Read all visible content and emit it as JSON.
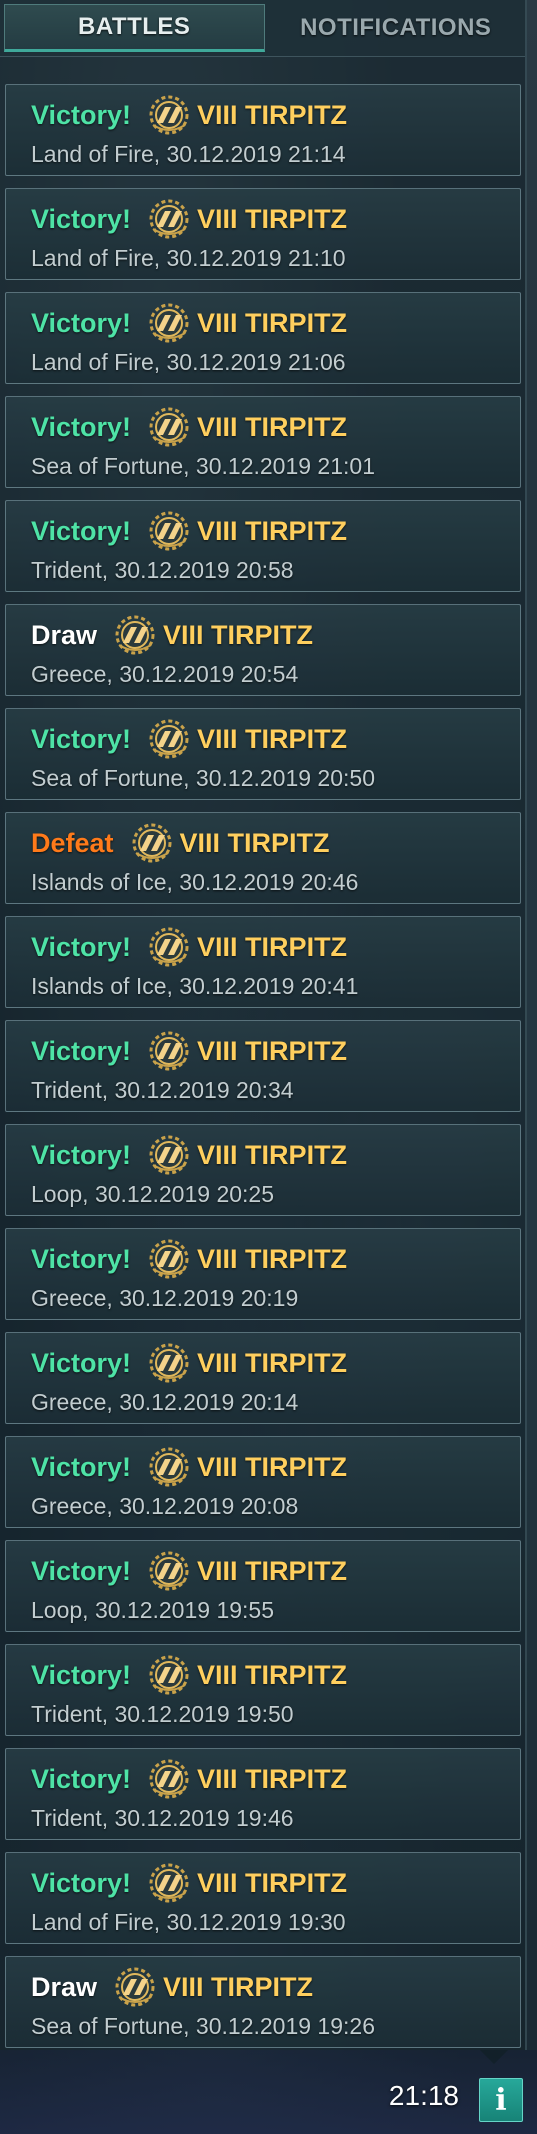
{
  "tabs": [
    {
      "label": "BATTLES",
      "active": true
    },
    {
      "label": "NOTIFICATIONS",
      "active": false
    }
  ],
  "colors": {
    "victory": "#4ee3a6",
    "draw": "#ffffff",
    "defeat": "#ff7a1a",
    "ship": "#ffcf5e",
    "accent": "#27a89a"
  },
  "battles": [
    {
      "result": "Victory!",
      "type": "victory",
      "ship": "VIII TIRPITZ",
      "details": "Land of Fire, 30.12.2019 21:14"
    },
    {
      "result": "Victory!",
      "type": "victory",
      "ship": "VIII TIRPITZ",
      "details": "Land of Fire, 30.12.2019 21:10"
    },
    {
      "result": "Victory!",
      "type": "victory",
      "ship": "VIII TIRPITZ",
      "details": "Land of Fire, 30.12.2019 21:06"
    },
    {
      "result": "Victory!",
      "type": "victory",
      "ship": "VIII TIRPITZ",
      "details": "Sea of Fortune, 30.12.2019 21:01"
    },
    {
      "result": "Victory!",
      "type": "victory",
      "ship": "VIII TIRPITZ",
      "details": "Trident, 30.12.2019 20:58"
    },
    {
      "result": "Draw",
      "type": "draw",
      "ship": "VIII TIRPITZ",
      "details": "Greece, 30.12.2019 20:54"
    },
    {
      "result": "Victory!",
      "type": "victory",
      "ship": "VIII TIRPITZ",
      "details": "Sea of Fortune, 30.12.2019 20:50"
    },
    {
      "result": "Defeat",
      "type": "defeat",
      "ship": "VIII TIRPITZ",
      "details": "Islands of Ice, 30.12.2019 20:46"
    },
    {
      "result": "Victory!",
      "type": "victory",
      "ship": "VIII TIRPITZ",
      "details": "Islands of Ice, 30.12.2019 20:41"
    },
    {
      "result": "Victory!",
      "type": "victory",
      "ship": "VIII TIRPITZ",
      "details": "Trident, 30.12.2019 20:34"
    },
    {
      "result": "Victory!",
      "type": "victory",
      "ship": "VIII TIRPITZ",
      "details": "Loop, 30.12.2019 20:25"
    },
    {
      "result": "Victory!",
      "type": "victory",
      "ship": "VIII TIRPITZ",
      "details": "Greece, 30.12.2019 20:19"
    },
    {
      "result": "Victory!",
      "type": "victory",
      "ship": "VIII TIRPITZ",
      "details": "Greece, 30.12.2019 20:14"
    },
    {
      "result": "Victory!",
      "type": "victory",
      "ship": "VIII TIRPITZ",
      "details": "Greece, 30.12.2019 20:08"
    },
    {
      "result": "Victory!",
      "type": "victory",
      "ship": "VIII TIRPITZ",
      "details": "Loop, 30.12.2019 19:55"
    },
    {
      "result": "Victory!",
      "type": "victory",
      "ship": "VIII TIRPITZ",
      "details": "Trident, 30.12.2019 19:50"
    },
    {
      "result": "Victory!",
      "type": "victory",
      "ship": "VIII TIRPITZ",
      "details": "Trident, 30.12.2019 19:46"
    },
    {
      "result": "Victory!",
      "type": "victory",
      "ship": "VIII TIRPITZ",
      "details": "Land of Fire, 30.12.2019 19:30"
    },
    {
      "result": "Draw",
      "type": "draw",
      "ship": "VIII TIRPITZ",
      "details": "Sea of Fortune, 30.12.2019 19:26"
    }
  ],
  "status": {
    "clock": "21:18",
    "info_icon": "info-icon",
    "info_label": "i"
  }
}
